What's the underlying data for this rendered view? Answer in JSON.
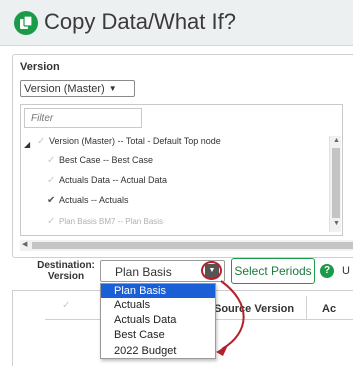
{
  "header": {
    "title": "Copy Data/What If?",
    "accent_color": "#1b9a4a"
  },
  "version": {
    "label": "Version",
    "selected": "Version (Master)"
  },
  "tree": {
    "filter_placeholder": "Filter",
    "rows": [
      {
        "label": "Version (Master) -- Total - Default Top node",
        "checked": false
      },
      {
        "label": "Best Case -- Best Case",
        "checked": false
      },
      {
        "label": "Actuals Data -- Actual Data",
        "checked": false
      },
      {
        "label": "Actuals -- Actuals",
        "checked": true
      },
      {
        "label": "Plan Basis BM7 -- Plan Basis",
        "checked": false
      }
    ]
  },
  "destination": {
    "label": "Destination: Version",
    "selected": "Plan Basis",
    "options": [
      "Plan Basis",
      "Actuals",
      "Actuals Data",
      "Best Case",
      "2022 Budget"
    ],
    "highlight_color": "#b3212a"
  },
  "actions": {
    "select_periods": "Select Periods",
    "help": "?",
    "cut_text": "U"
  },
  "table": {
    "columns": [
      "Source Version",
      "Ac"
    ]
  }
}
